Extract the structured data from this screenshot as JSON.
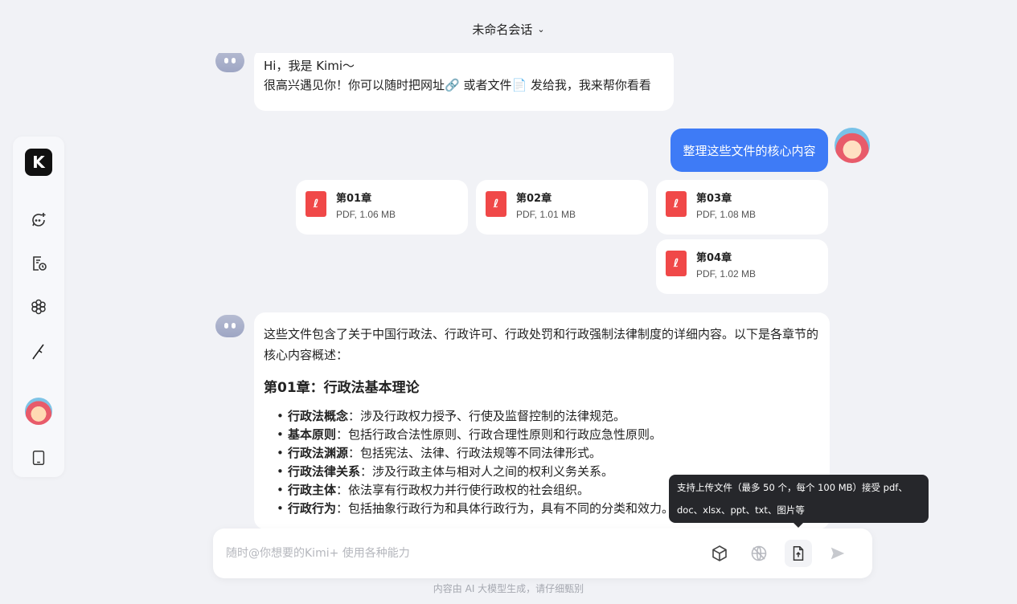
{
  "header": {
    "title": "未命名会话"
  },
  "sidebar": {
    "logo": "K",
    "items": [
      {
        "name": "new-chat"
      },
      {
        "name": "history"
      },
      {
        "name": "explore"
      },
      {
        "name": "writing"
      },
      {
        "name": "profile"
      },
      {
        "name": "mobile"
      }
    ]
  },
  "messages": {
    "greeting": {
      "line1": "Hi，我是 Kimi～",
      "line2": "很高兴遇见你！你可以随时把网址🔗 或者文件📄 发给我，我来帮你看看"
    },
    "user_prompt": "整理这些文件的核心内容",
    "files": [
      {
        "name": "第01章",
        "meta": "PDF, 1.06 MB"
      },
      {
        "name": "第02章",
        "meta": "PDF, 1.01 MB"
      },
      {
        "name": "第03章",
        "meta": "PDF, 1.08 MB"
      },
      {
        "name": "第04章",
        "meta": "PDF, 1.02 MB"
      }
    ],
    "answer": {
      "intro": "这些文件包含了关于中国行政法、行政许可、行政处罚和行政强制法律制度的详细内容。以下是各章节的核心内容概述：",
      "heading": "第01章：行政法基本理论",
      "bullets": [
        {
          "term": "行政法概念",
          "text": "：涉及行政权力授予、行使及监督控制的法律规范。"
        },
        {
          "term": "基本原则",
          "text": "：包括行政合法性原则、行政合理性原则和行政应急性原则。"
        },
        {
          "term": "行政法渊源",
          "text": "：包括宪法、法律、行政法规等不同法律形式。"
        },
        {
          "term": "行政法律关系",
          "text": "：涉及行政主体与相对人之间的权利义务关系。"
        },
        {
          "term": "行政主体",
          "text": "：依法享有行政权力并行使行政权的社会组织。"
        },
        {
          "term": "行政行为",
          "text": "：包括抽象行政行为和具体行政行为，具有不同的分类和效力。"
        }
      ]
    }
  },
  "tooltip": {
    "line1": "支持上传文件（最多 50 个，每个 100 MB）接受 pdf、",
    "line2": "doc、xlsx、ppt、txt、图片等"
  },
  "input": {
    "placeholder": "随时@你想要的Kimi+ 使用各种能力"
  },
  "footer": {
    "note": "内容由 AI 大模型生成，请仔细甄别"
  },
  "colors": {
    "accent": "#3e7bf6",
    "pdf": "#f04848",
    "tooltip": "#26272b"
  }
}
